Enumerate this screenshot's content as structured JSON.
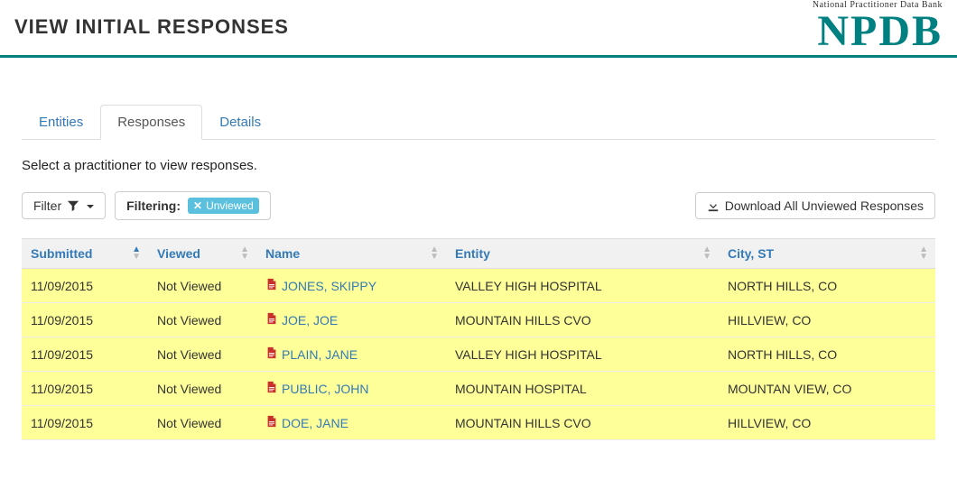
{
  "header": {
    "title": "VIEW INITIAL RESPONSES",
    "logo_small": "National Practitioner Data Bank",
    "logo_large": "NPDB"
  },
  "tabs": [
    {
      "label": "Entities",
      "active": false
    },
    {
      "label": "Responses",
      "active": true
    },
    {
      "label": "Details",
      "active": false
    }
  ],
  "instruction": "Select a practitioner to view responses.",
  "toolbar": {
    "filter_button": "Filter",
    "filtering_label": "Filtering:",
    "filter_tag": "Unviewed",
    "download_button": "Download All Unviewed Responses"
  },
  "columns": {
    "submitted": "Submitted",
    "viewed": "Viewed",
    "name": "Name",
    "entity": "Entity",
    "city_st": "City, ST"
  },
  "rows": [
    {
      "submitted": "11/09/2015",
      "viewed": "Not Viewed",
      "name": "JONES, SKIPPY",
      "entity": "VALLEY HIGH HOSPITAL",
      "city_st": "NORTH HILLS, CO"
    },
    {
      "submitted": "11/09/2015",
      "viewed": "Not Viewed",
      "name": "JOE, JOE",
      "entity": "MOUNTAIN HILLS CVO",
      "city_st": "HILLVIEW, CO"
    },
    {
      "submitted": "11/09/2015",
      "viewed": "Not Viewed",
      "name": "PLAIN, JANE",
      "entity": "VALLEY HIGH HOSPITAL",
      "city_st": "NORTH HILLS, CO"
    },
    {
      "submitted": "11/09/2015",
      "viewed": "Not Viewed",
      "name": "PUBLIC, JOHN",
      "entity": "MOUNTAIN HOSPITAL",
      "city_st": "MOUNTAN VIEW, CO"
    },
    {
      "submitted": "11/09/2015",
      "viewed": "Not Viewed",
      "name": "DOE, JANE",
      "entity": "MOUNTAIN HILLS CVO",
      "city_st": "HILLVIEW, CO"
    }
  ]
}
